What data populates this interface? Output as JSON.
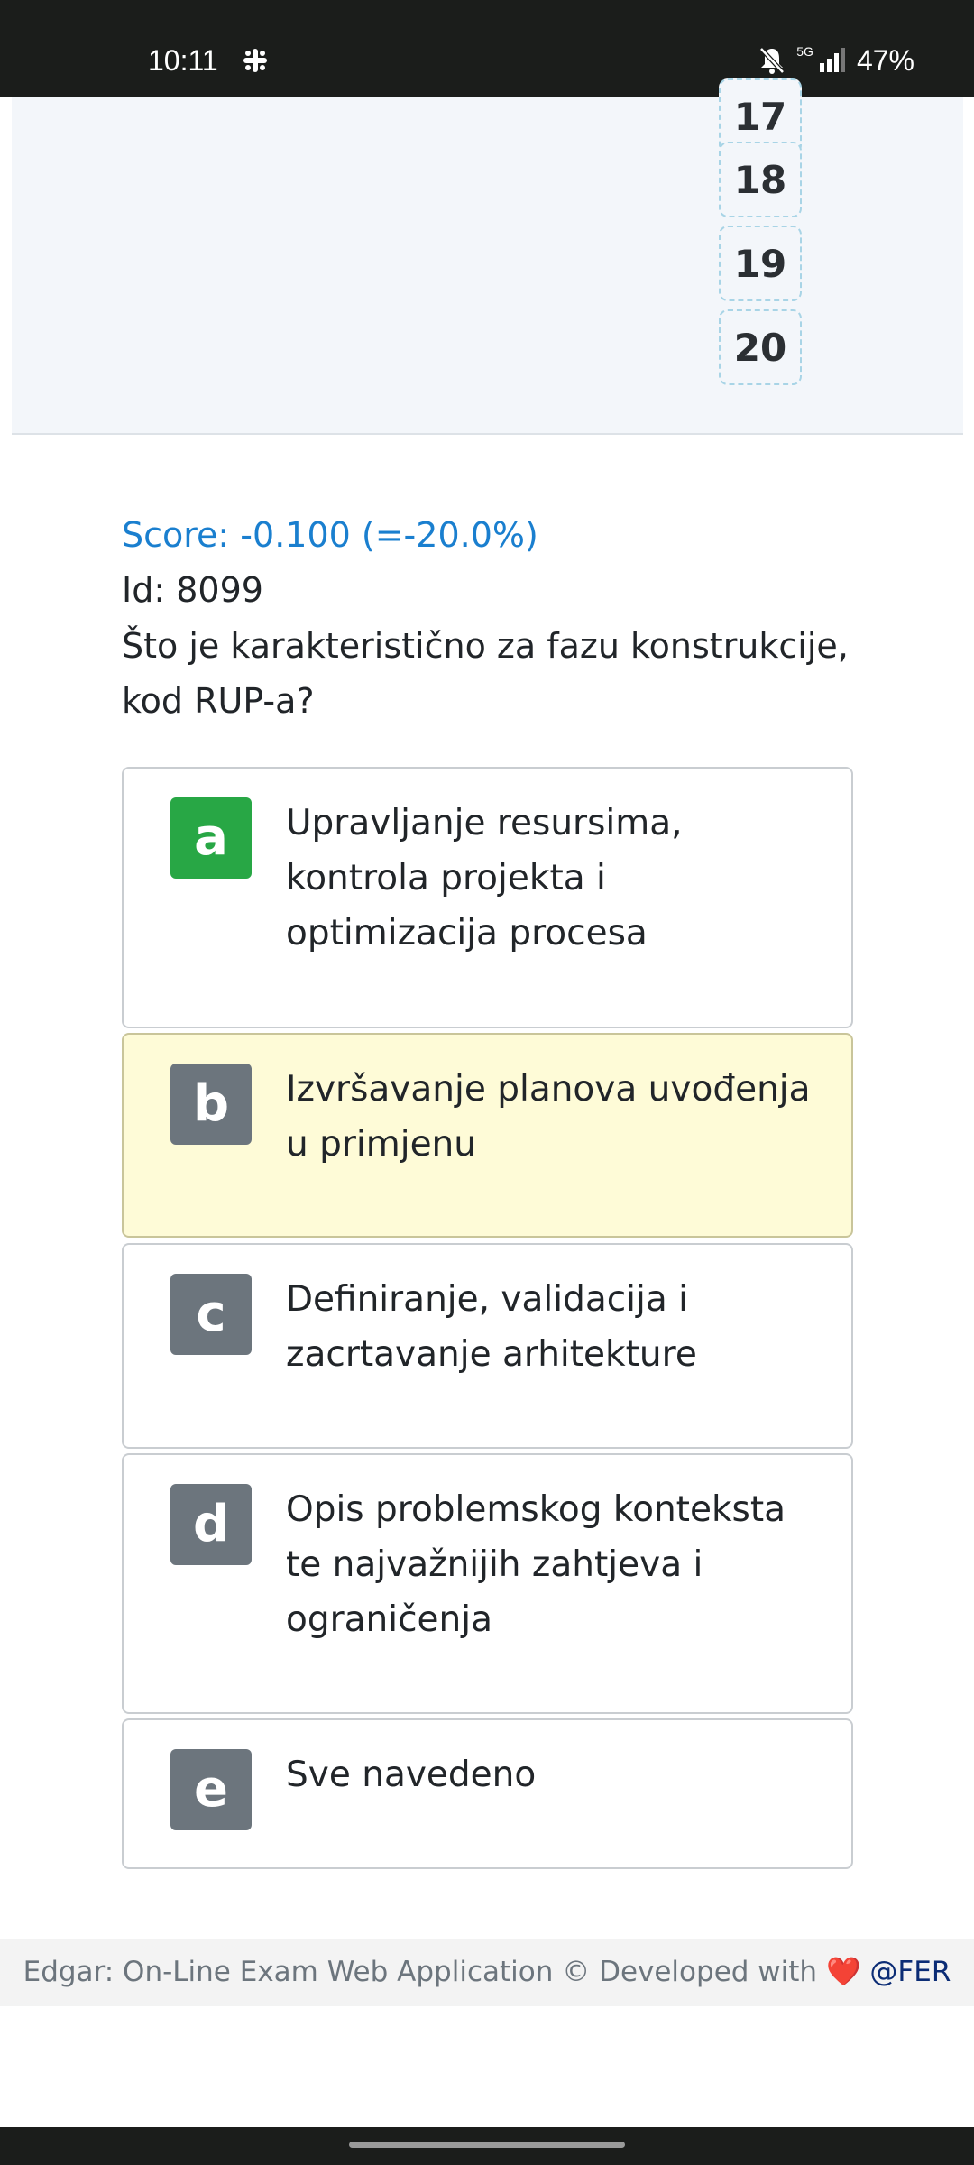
{
  "status_bar": {
    "time": "10:11",
    "network": "5G",
    "battery": "47%",
    "icons": [
      "slack-icon",
      "mute-bell-icon",
      "signal-icon"
    ]
  },
  "question_numbers": [
    "17",
    "18",
    "19",
    "20"
  ],
  "question": {
    "score": "Score: -0.100 (=-20.0%)",
    "id": "Id: 8099",
    "text": "Što je karakteristično za fazu konstrukcije, kod RUP-a?"
  },
  "answers": [
    {
      "letter": "a",
      "text": "Upravljanje resursima, kontrola projekta i optimizacija procesa",
      "state": "correct"
    },
    {
      "letter": "b",
      "text": "Izvršavanje planova uvođenja u primjenu",
      "state": "selected"
    },
    {
      "letter": "c",
      "text": "Definiranje, validacija i zacrtavanje arhitekture",
      "state": "none"
    },
    {
      "letter": "d",
      "text": "Opis problemskog konteksta te najvažnijih zahtjeva i ograničenja",
      "state": "none"
    },
    {
      "letter": "e",
      "text": "Sve navedeno",
      "state": "none"
    }
  ],
  "footer": {
    "text": "Edgar: On-Line Exam Web Application © Developed with",
    "heart": "❤️",
    "link": "@FER"
  },
  "colors": {
    "correct": "#28a745",
    "selected_bg": "#fefbd7",
    "score": "#1a7fcf",
    "badge_default": "#6c757d"
  }
}
